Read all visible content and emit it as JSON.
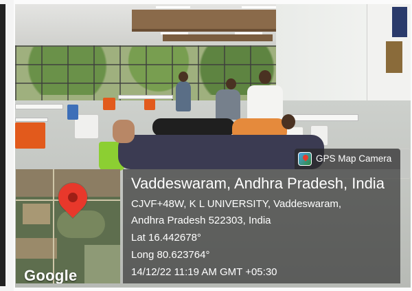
{
  "overlay": {
    "app_name": "GPS Map Camera",
    "location_title": "Vaddeswaram, Andhra Pradesh, India",
    "address_line_1": "CJVF+48W, K L UNIVERSITY, Vaddeswaram,",
    "address_line_2": "Andhra Pradesh 522303, India",
    "latitude": "Lat 16.442678°",
    "longitude": "Long 80.623764°",
    "timestamp": "14/12/22 11:19 AM GMT +05:30",
    "map_attribution": "Google",
    "app_icon": "gps-map-camera-icon",
    "map_marker": "map-pin-icon"
  },
  "colors": {
    "panel_background": "#232323",
    "text": "#ffffff",
    "map_pin": "#e8382b"
  }
}
